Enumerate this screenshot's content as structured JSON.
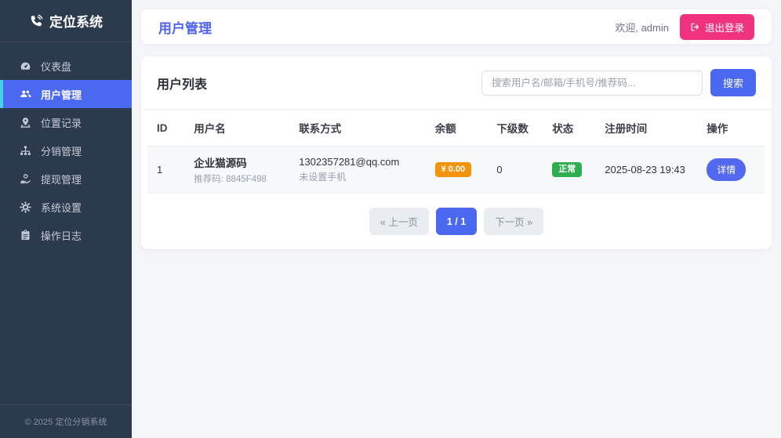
{
  "app": {
    "logo_text": "定位系统",
    "footer": "© 2025 定位分销系统"
  },
  "sidebar": {
    "items": [
      {
        "label": "仪表盘",
        "icon": "tachometer-icon",
        "active": false
      },
      {
        "label": "用户管理",
        "icon": "users-icon",
        "active": true
      },
      {
        "label": "位置记录",
        "icon": "map-marker-icon",
        "active": false
      },
      {
        "label": "分销管理",
        "icon": "sitemap-icon",
        "active": false
      },
      {
        "label": "提现管理",
        "icon": "hand-holding-money-icon",
        "active": false
      },
      {
        "label": "系统设置",
        "icon": "gear-icon",
        "active": false
      },
      {
        "label": "操作日志",
        "icon": "clipboard-icon",
        "active": false
      }
    ]
  },
  "header": {
    "title": "用户管理",
    "welcome": "欢迎, admin",
    "logout_label": "退出登录"
  },
  "list_card": {
    "title": "用户列表",
    "search_placeholder": "搜索用户名/邮箱/手机号/推荐码...",
    "search_button": "搜索",
    "table": {
      "headers": [
        "ID",
        "用户名",
        "联系方式",
        "余额",
        "下级数",
        "状态",
        "注册时间",
        "操作"
      ],
      "rows": [
        {
          "id": "1",
          "username": "企业猫源码",
          "referral": "推荐码: 8845F498",
          "email": "1302357281@qq.com",
          "phone": "未设置手机",
          "balance": "¥ 0.00",
          "subordinates": "0",
          "status": "正常",
          "registered": "2025-08-23 19:43",
          "action": "详情"
        }
      ]
    },
    "pagination": {
      "prev": "« 上一页",
      "current": "1 / 1",
      "next": "下一页 »"
    }
  },
  "colors": {
    "primary_blue": "#4a68f0",
    "sidebar_bg": "#2c3a4d",
    "active_border_cyan": "#45d0e8",
    "logout_pink": "#f1337f",
    "balance_orange": "#f2930d",
    "status_green": "#2eae4e"
  }
}
